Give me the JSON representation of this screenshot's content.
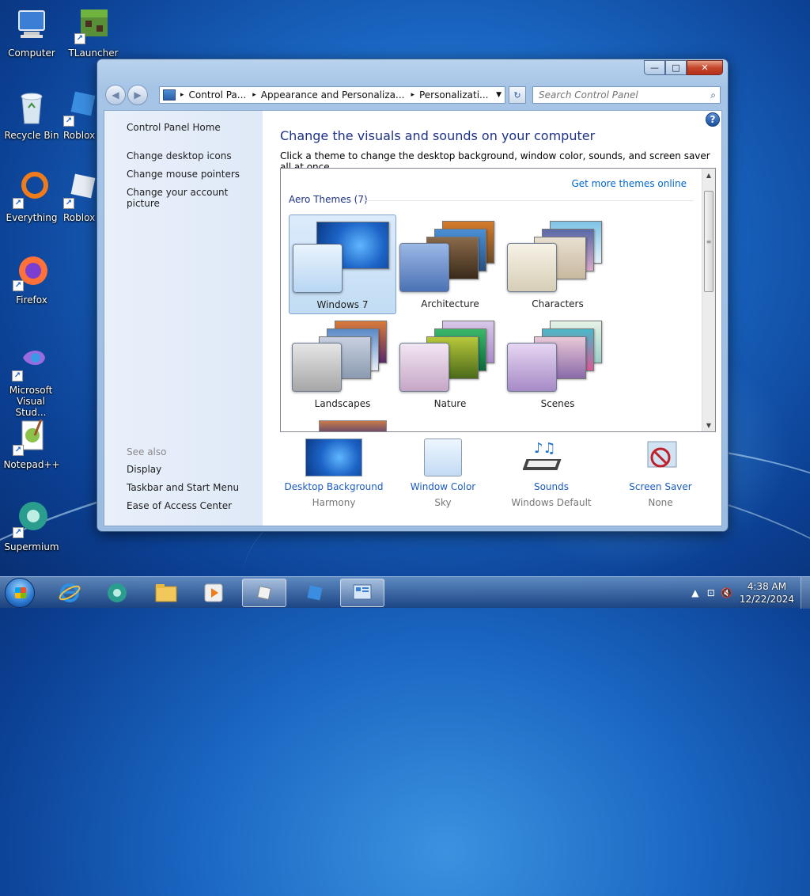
{
  "desktop": {
    "icons": [
      {
        "label": "Computer"
      },
      {
        "label": "TLauncher"
      },
      {
        "label": "Recycle Bin"
      },
      {
        "label": "Roblox S"
      },
      {
        "label": "Everything"
      },
      {
        "label": "Roblox I"
      },
      {
        "label": "Firefox"
      },
      {
        "label": "Microsoft Visual Stud..."
      },
      {
        "label": "Notepad++"
      },
      {
        "label": "Supermium"
      }
    ]
  },
  "window": {
    "caption_buttons": {
      "minimize": "—",
      "maximize": "□",
      "close": "✕"
    },
    "nav": {
      "back_icon": "◀",
      "forward_icon": "▶"
    },
    "breadcrumb": [
      "Control Pa...",
      "Appearance and Personaliza...",
      "Personalizati..."
    ],
    "breadcrumb_sep": "▸",
    "address_dropdown": "▼",
    "refresh_icon": "↻",
    "search": {
      "placeholder": "Search Control Panel",
      "icon": "⌕"
    },
    "left_pane": {
      "home": "Control Panel Home",
      "links": [
        "Change desktop icons",
        "Change mouse pointers",
        "Change your account picture"
      ],
      "see_also_title": "See also",
      "see_also": [
        "Display",
        "Taskbar and Start Menu",
        "Ease of Access Center"
      ]
    },
    "main": {
      "help_icon": "?",
      "title": "Change the visuals and sounds on your computer",
      "subtitle": "Click a theme to change the desktop background, window color, sounds, and screen saver all at once.",
      "get_more": "Get more themes online",
      "group_title": "Aero Themes (7)",
      "themes": [
        {
          "name": "Windows 7",
          "selected": true
        },
        {
          "name": "Architecture",
          "selected": false
        },
        {
          "name": "Characters",
          "selected": false
        },
        {
          "name": "Landscapes",
          "selected": false
        },
        {
          "name": "Nature",
          "selected": false
        },
        {
          "name": "Scenes",
          "selected": false
        }
      ],
      "scroll": {
        "up": "▲",
        "down": "▼",
        "grip": "≡"
      },
      "bottom": [
        {
          "label": "Desktop Background",
          "value": "Harmony"
        },
        {
          "label": "Window Color",
          "value": "Sky"
        },
        {
          "label": "Sounds",
          "value": "Windows Default"
        },
        {
          "label": "Screen Saver",
          "value": "None"
        }
      ]
    }
  },
  "taskbar": {
    "tray": {
      "up_arrow": "▲",
      "network": "⊡",
      "volume": "🔇"
    },
    "time": "4:38 AM",
    "date": "12/22/2024"
  },
  "colors": {
    "link": "#1a5cbf",
    "heading": "#1e3287",
    "accent": "#0066cc"
  }
}
